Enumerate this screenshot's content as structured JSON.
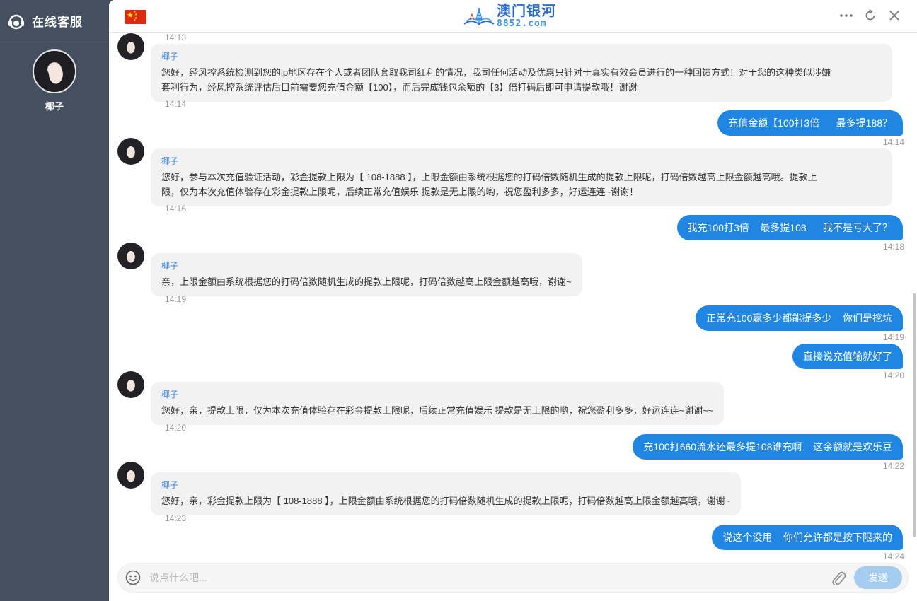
{
  "sidebar": {
    "title": "在线客服",
    "agent_name": "椰子"
  },
  "header": {
    "logo_cn": "澳门银河",
    "logo_en": "8852.com",
    "icons": [
      "china-flag-icon",
      "more-icon",
      "refresh-icon",
      "close-icon"
    ]
  },
  "messages": {
    "t0": "14:13",
    "m1": {
      "sender": "椰子",
      "line1": "您好，经风控系统检测到您的ip地区存在个人或者团队套取我司红利的情况，我司任何活动及优惠只针对于真实有效会员进行的一种回馈方式！对于您的这种类似涉嫌",
      "line2": "套利行为，经风控系统评估后目前需要您充值金额【100】，而后完成钱包余额的【3】倍打码后即可申请提款哦！谢谢",
      "time": "14:14"
    },
    "o1": {
      "text": "充值金额【100打3倍      最多提188？",
      "time": "14:14"
    },
    "m2": {
      "sender": "椰子",
      "line1": "您好，参与本次充值验证活动，彩金提款上限为【 108-1888 】，上限金额由系统根据您的打码倍数随机生成的提款上限呢，打码倍数越高上限金额越高哦。提款上",
      "line2": "限，仅为本次充值体验存在彩金提款上限呢，后续正常充值娱乐 提款是无上限的哟，祝您盈利多多，好运连连~谢谢！",
      "time": "14:16"
    },
    "o2": {
      "text": "我充100打3倍    最多提108      我不是亏大了？",
      "time": "14:18"
    },
    "m3": {
      "sender": "椰子",
      "line1": "亲，上限金额由系统根据您的打码倍数随机生成的提款上限呢，打码倍数越高上限金额越高哦，谢谢~",
      "time": "14:19"
    },
    "o3": {
      "text": "正常充100赢多少都能提多少    你们是挖坑",
      "time": "14:19"
    },
    "o4": {
      "text": "直接说充值输就好了",
      "time": "14:20"
    },
    "m4": {
      "sender": "椰子",
      "line1": "您好，亲，提款上限，仅为本次充值体验存在彩金提款上限呢，后续正常充值娱乐 提款是无上限的哟，祝您盈利多多，好运连连~谢谢~~",
      "time": "14:20"
    },
    "o5": {
      "text": "充100打660流水还最多提108谁充啊    这余额就是欢乐豆",
      "time": "14:22"
    },
    "m5": {
      "sender": "椰子",
      "line1": "您好，亲，彩金提款上限为【 108-1888 】，上限金额由系统根据您的打码倍数随机生成的提款上限呢，打码倍数越高上限金额越高哦，谢谢~",
      "time": "14:23"
    },
    "o6": {
      "text": "说这个没用    你们允许都是按下限来的",
      "time": "14:24"
    }
  },
  "input": {
    "placeholder": "说点什么吧...",
    "send_label": "发送"
  },
  "colors": {
    "sidebar_bg": "#44505f",
    "outgoing_bubble": "#1f86e4",
    "incoming_bubble": "#f2f2f2",
    "send_button": "#a6cdf0"
  }
}
